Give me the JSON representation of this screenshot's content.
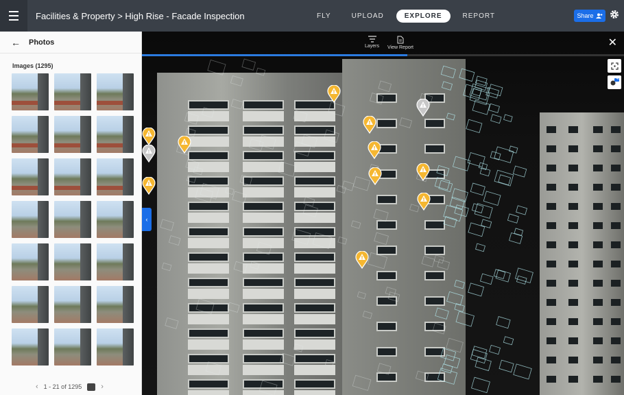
{
  "header": {
    "title": "Facilities & Property > High Rise - Facade Inspection",
    "tabs": [
      {
        "label": "FLY",
        "active": false
      },
      {
        "label": "UPLOAD",
        "active": false
      },
      {
        "label": "EXPLORE",
        "active": true
      },
      {
        "label": "REPORT",
        "active": false
      }
    ],
    "share_label": "Share"
  },
  "panel": {
    "title": "Photos",
    "images_label": "Images (1295)",
    "pager_text": "1 - 21 of 1295",
    "thumbnail_count": 21
  },
  "viewer": {
    "tools": [
      {
        "label": "Layers",
        "icon": "filter-icon"
      },
      {
        "label": "View Report",
        "icon": "document-icon"
      }
    ],
    "load_progress": 0.55,
    "side_badge": "40",
    "annotation_pins": 14
  },
  "colors": {
    "topbar": "#3a4048",
    "accent": "#1b6ee8",
    "pin_warning": "#f5b731",
    "pin_neutral": "#c8c8c8"
  }
}
